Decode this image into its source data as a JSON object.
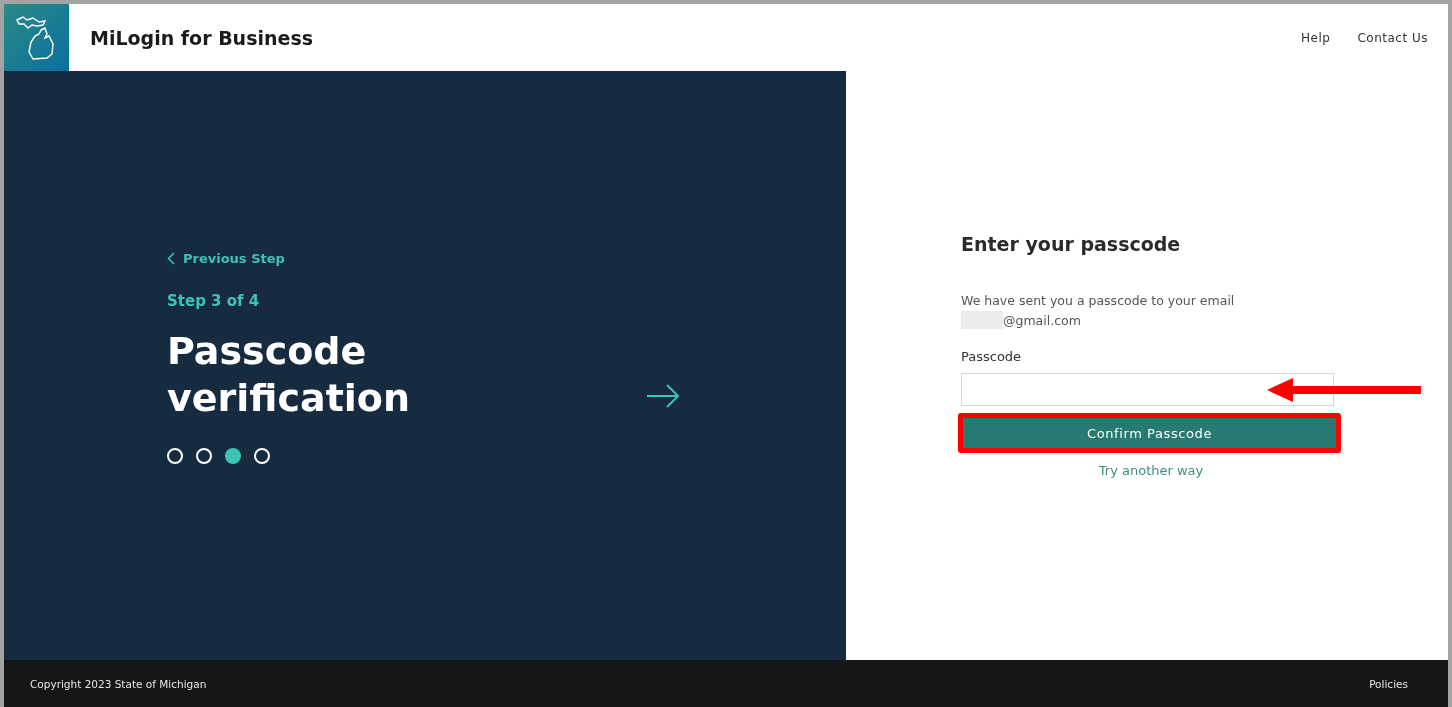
{
  "header": {
    "title": "MiLogin for Business",
    "links": [
      "Help",
      "Contact Us"
    ]
  },
  "progress": {
    "back_link": "Previous Step",
    "step": "Step 3 of 4",
    "title": "Passcode verification",
    "dots": [
      {
        "selected": false
      },
      {
        "selected": false
      },
      {
        "selected": true
      },
      {
        "selected": false
      }
    ]
  },
  "form": {
    "heading": "Enter your passcode",
    "message": "We have sent you a passcode to your email",
    "email": "@gmail.com",
    "email_redacted": true,
    "field_label": "Passcode",
    "submit": "Confirm Passcode",
    "alt_link": "Try another way",
    "highlight_submit": true,
    "arrow_to_field": true
  },
  "footer": {
    "copyright": "Copyright 2023 State of Michigan",
    "links": [
      "Policies"
    ]
  }
}
